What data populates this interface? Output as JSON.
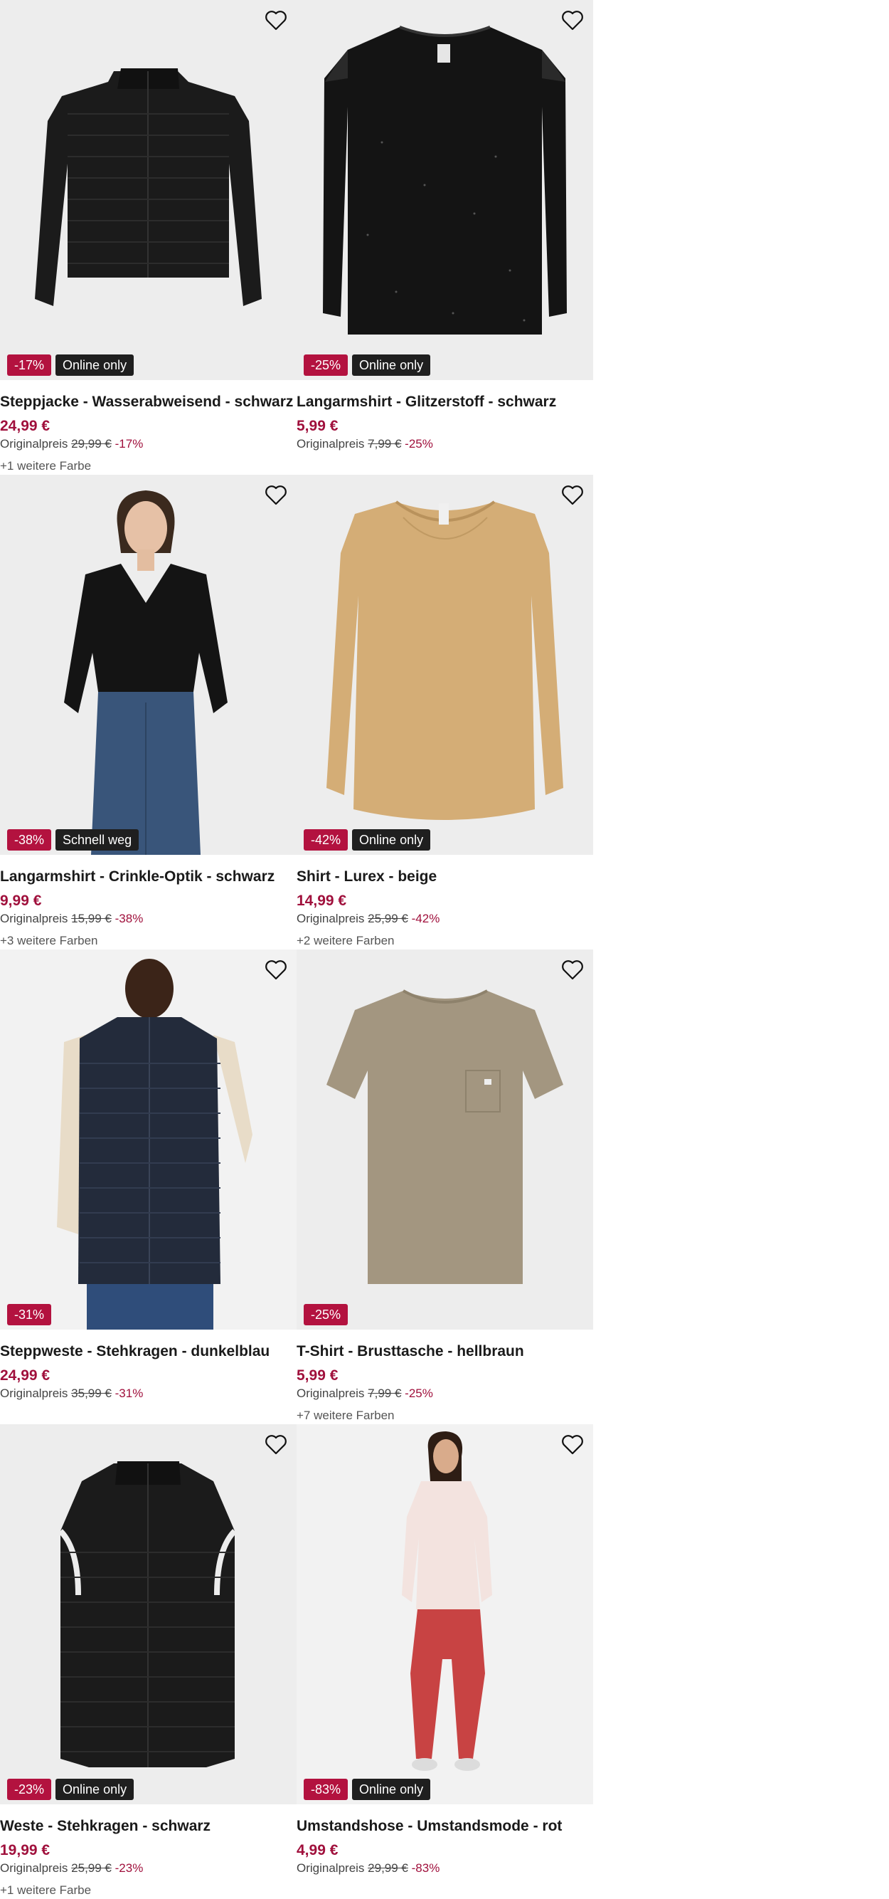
{
  "products": [
    {
      "name": "Steppjacke - Wasserabweisend - schwarz",
      "price": "24,99 €",
      "original_label": "Originalpreis",
      "original_price": "29,99 €",
      "discount": "-17%",
      "badge_discount": "-17%",
      "badge_tag": "Online only",
      "more_colors": "+1 weitere Farbe",
      "image": "black-puffer-jacket"
    },
    {
      "name": "Langarmshirt - Glitzerstoff - schwarz",
      "price": "5,99 €",
      "original_label": "Originalpreis",
      "original_price": "7,99 €",
      "discount": "-25%",
      "badge_discount": "-25%",
      "badge_tag": "Online only",
      "more_colors": "",
      "image": "black-glitter-longsleeve"
    },
    {
      "name": "Langarmshirt - Crinkle-Optik - schwarz",
      "price": "9,99 €",
      "original_label": "Originalpreis",
      "original_price": "15,99 €",
      "discount": "-38%",
      "badge_discount": "-38%",
      "badge_tag": "Schnell weg",
      "more_colors": "+3 weitere Farben",
      "image": "woman-black-blouse"
    },
    {
      "name": "Shirt - Lurex - beige",
      "price": "14,99 €",
      "original_label": "Originalpreis",
      "original_price": "25,99 €",
      "discount": "-42%",
      "badge_discount": "-42%",
      "badge_tag": "Online only",
      "more_colors": "+2 weitere Farben",
      "image": "beige-longsleeve"
    },
    {
      "name": "Steppweste - Stehkragen - dunkelblau",
      "price": "24,99 €",
      "original_label": "Originalpreis",
      "original_price": "35,99 €",
      "discount": "-31%",
      "badge_discount": "-31%",
      "badge_tag": "",
      "more_colors": "",
      "image": "man-navy-vest"
    },
    {
      "name": "T-Shirt - Brusttasche - hellbraun",
      "price": "5,99 €",
      "original_label": "Originalpreis",
      "original_price": "7,99 €",
      "discount": "-25%",
      "badge_discount": "-25%",
      "badge_tag": "",
      "more_colors": "+7 weitere Farben",
      "image": "brown-tshirt"
    },
    {
      "name": "Weste - Stehkragen - schwarz",
      "price": "19,99 €",
      "original_label": "Originalpreis",
      "original_price": "25,99 €",
      "discount": "-23%",
      "badge_discount": "-23%",
      "badge_tag": "Online only",
      "more_colors": "+1 weitere Farbe",
      "image": "black-vest"
    },
    {
      "name": "Umstandshose - Umstandsmode - rot",
      "price": "4,99 €",
      "original_label": "Originalpreis",
      "original_price": "29,99 €",
      "discount": "-83%",
      "badge_discount": "-83%",
      "badge_tag": "Online only",
      "more_colors": "",
      "image": "woman-red-maternity-pants"
    }
  ],
  "icons": {
    "favorite": "heart-outline-icon"
  },
  "colors": {
    "accent": "#a0103c",
    "badge_discount": "#b3123f",
    "badge_tag": "#1f1f1f",
    "image_bg": "#ededed"
  }
}
